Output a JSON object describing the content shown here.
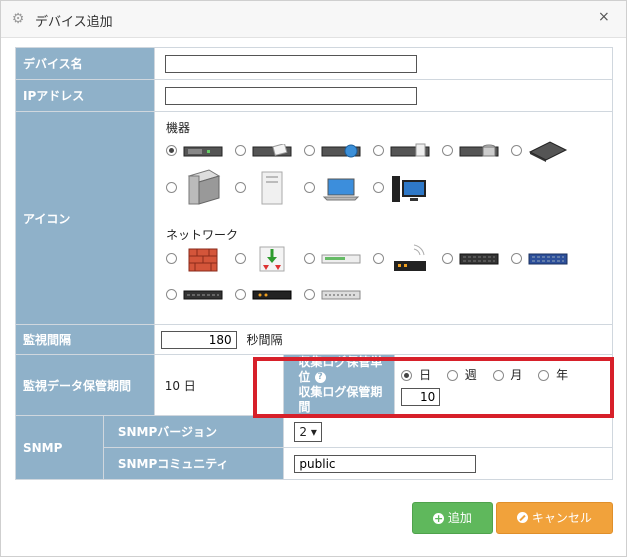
{
  "dialog": {
    "title": "デバイス追加",
    "close_glyph": "×"
  },
  "form": {
    "device_name": {
      "label": "デバイス名",
      "value": ""
    },
    "ip_address": {
      "label": "IPアドレス",
      "value": ""
    },
    "icon": {
      "label": "アイコン",
      "group_equipment": "機器",
      "group_network": "ネットワーク",
      "equipment_icons": [
        "server-1u-icon",
        "server-1u-paper-icon",
        "server-1u-globe-icon",
        "server-1u-drive-icon",
        "server-db-icon",
        "server-flat-icon",
        "storage-box-icon",
        "tower-server-icon",
        "laptop-icon",
        "desktop-pc-icon"
      ],
      "network_icons": [
        "firewall-icon",
        "router-arrows-icon",
        "switch-white-icon",
        "wifi-router-icon",
        "switch-black-icon",
        "switch-blue-icon",
        "switch-small-icon",
        "switch-dark-icon",
        "switch-gray-icon"
      ],
      "selected_index": 0
    },
    "monitor_interval": {
      "label": "監視間隔",
      "value": "180",
      "unit": "秒間隔"
    },
    "retention": {
      "label": "監視データ保管期間",
      "value": "10 日",
      "log_unit_label": "収集ログ保管単位",
      "help_glyph": "?",
      "log_period_label": "収集ログ保管期間",
      "units": [
        "日",
        "週",
        "月",
        "年"
      ],
      "selected_unit": "日",
      "log_period_value": "10"
    },
    "snmp": {
      "label": "SNMP",
      "version_label": "SNMPバージョン",
      "version_value": "2 ▾",
      "community_label": "SNMPコミュニティ",
      "community_value": "public"
    }
  },
  "buttons": {
    "add": "追加",
    "cancel": "キャンセル"
  }
}
